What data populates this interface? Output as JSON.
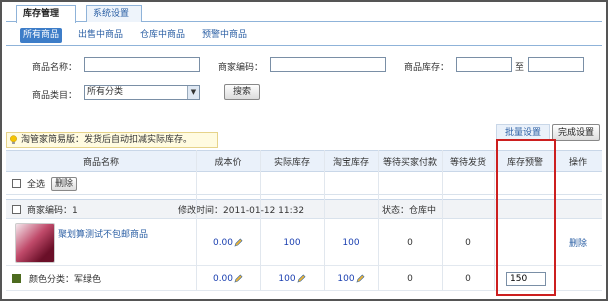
{
  "top_tabs": {
    "inventory": "库存管理",
    "settings": "系统设置"
  },
  "sub_tabs": {
    "all": "所有商品",
    "on_sale": "出售中商品",
    "in_warehouse": "仓库中商品",
    "warning": "预警中商品"
  },
  "search": {
    "name_label": "商品名称：",
    "code_label": "商家编码：",
    "stock_label": "商品库存：",
    "to_label": "至",
    "category_label": "商品类目：",
    "category_value": "所有分类",
    "search_button": "搜索",
    "name_value": "",
    "code_value": "",
    "stock_min": "",
    "stock_max": ""
  },
  "notice": "淘管家简易版：发货后自动扣减实际库存。",
  "toolbar": {
    "batch_settings": "批量设置",
    "done_settings": "完成设置"
  },
  "table": {
    "headers": [
      "商品名称",
      "成本价",
      "实际库存",
      "淘宝库存",
      "等待买家付款",
      "等待发货",
      "库存预警",
      "操作"
    ],
    "select_all": "全选",
    "delete_button": "删除",
    "group": {
      "code": "商家编码：1",
      "modified": "修改时间：2011-01-12 11:32",
      "status": "状态：仓库中"
    },
    "product": {
      "title": "聚划算测试不包邮商品",
      "cost": "0.00",
      "actual_stock": "100",
      "taobao_stock": "100",
      "awaiting_payment": "0",
      "awaiting_shipment": "0",
      "action": "删除"
    },
    "variant": {
      "label": "颜色分类：军绿色",
      "cost": "0.00",
      "actual_stock": "100",
      "taobao_stock": "100",
      "awaiting_payment": "0",
      "awaiting_shipment": "0",
      "stock_warning": "150"
    }
  },
  "colors": {
    "accent": "#3d7dc8",
    "highlight_border": "#cc1f1f",
    "link": "#2b5fa4"
  }
}
